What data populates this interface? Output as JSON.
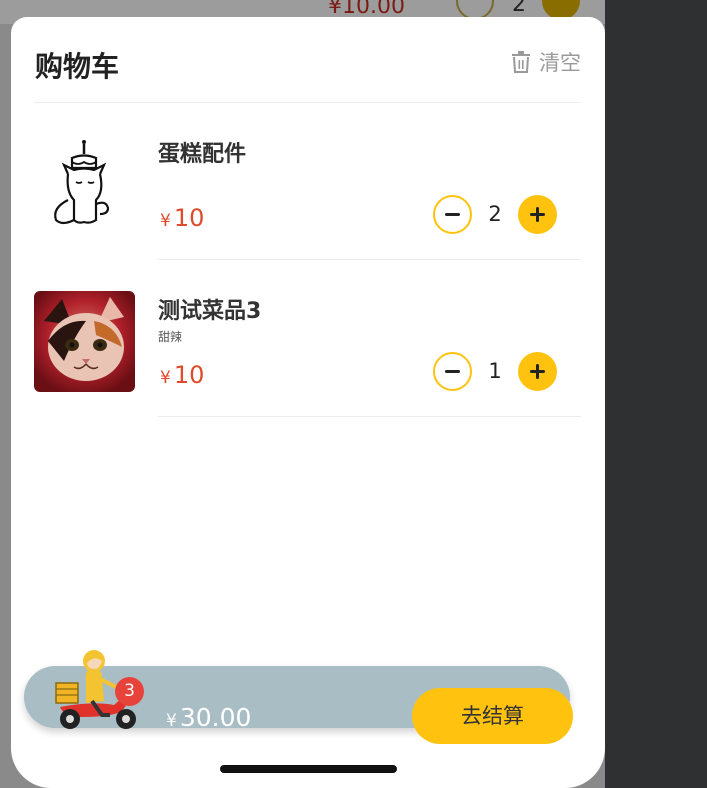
{
  "background": {
    "price_symbol": "¥",
    "price_value": "10.00",
    "qty": "2"
  },
  "header": {
    "title": "购物车",
    "clear_label": "清空"
  },
  "items": [
    {
      "name": "蛋糕配件",
      "spec": "",
      "currency": "¥",
      "price": "10",
      "qty": "2",
      "image": "cat-with-cake-illustration"
    },
    {
      "name": "测试菜品3",
      "spec": "甜辣",
      "currency": "¥",
      "price": "10",
      "qty": "1",
      "image": "calico-cat-photo"
    }
  ],
  "footer": {
    "badge_count": "3",
    "currency": "¥",
    "total": "30.00",
    "checkout_label": "去结算"
  },
  "colors": {
    "accent": "#ffc20e",
    "price": "#e04a2c",
    "bar": "#a9bec4",
    "badge": "#e8433a"
  },
  "icons": [
    "trash-icon",
    "minus-icon",
    "plus-icon",
    "delivery-scooter-icon"
  ]
}
